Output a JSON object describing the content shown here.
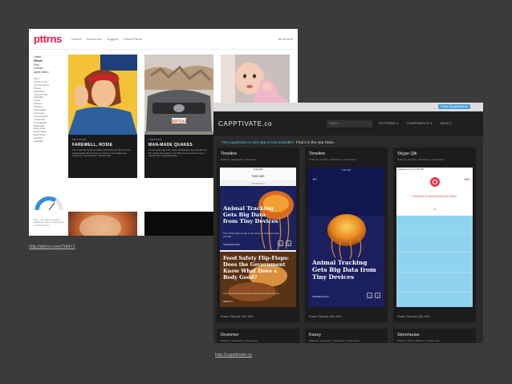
{
  "pttrns": {
    "logo": "pttrns",
    "nav": [
      "Search",
      "Resources",
      "Suggest",
      "Follow Pttrns"
    ],
    "filter": "All Items ▾",
    "devices": [
      "Latest",
      "iPhone",
      "iPad",
      "Android",
      "Apple Watch"
    ],
    "categories": [
      "About",
      "Activity Feeds",
      "Ads Promotions",
      "Browse",
      "Calculators",
      "Camera & Film",
      "Calendars",
      "Charts",
      "Check-in",
      "Checkout",
      "Coach Marks",
      "Comments",
      "Content Detail",
      "Create Post",
      "Cross Selling",
      "Dashboard",
      "Empty Data",
      "Empty States",
      "Event Detail",
      "Favorites",
      "Feedback"
    ],
    "gauge_caption": "Stat — Top Tab-bar, Android Dashboard, Ads by: Real Buying in Startup Brand",
    "cards": {
      "card1": {
        "tag": "FEATURED",
        "title": "FAREWELL, ROSIE",
        "desc": "The model for American Rosie with 'Rosie the Riveter' has passed away. But don't let our forever in the Halloween costumes of generations. Farewell girls."
      },
      "card2": {
        "tag": "TRENDING",
        "title": "MAN-MADE QUAKES",
        "desc": "A new study says man-made earthquakes are increasing in the central and eastern U.S. Which is just a better way of saying we're all getting flatter."
      },
      "plate": "3DFY243"
    },
    "url": "http://pttrns.com/?did=1"
  },
  "capptivate": {
    "follow": "Follow @capptivateco",
    "brand": "CAPPTIVATE.co",
    "search_placeholder": "Search...",
    "menu": [
      "PATTERNS ▾",
      "COMPONENTS ▾",
      "ABOUT"
    ],
    "banner_highlight": "The Capptivate.co iOS app is now available!",
    "banner_rest": "Find it in the App Store.",
    "cards": [
      {
        "title": "Timeline",
        "sub": "Patterns: Navigation, Transitions",
        "posted": "Posted: February 14th, 2015"
      },
      {
        "title": "Timeline",
        "sub": "Patterns: Content, Transitions, UI Elements",
        "posted": "Posted: February 14th, 2015"
      },
      {
        "title": "Skype Qik",
        "sub": "Patterns: Content, Interactive, UI Elements",
        "posted": "Posted: February 14th, 2015"
      }
    ],
    "cards_bottom": [
      {
        "title": "Drummer",
        "sub": "Patterns: Interactive, UI Elements"
      },
      {
        "title": "Keezy",
        "sub": "Patterns: Interactive, Transitions, UI Elements"
      },
      {
        "title": "Storehouse",
        "sub": "Patterns: Pull to Refresh, UI Elements"
      }
    ],
    "phone1": {
      "status_time": "9:41 AM",
      "title": "TIMELINE",
      "day": "YESTERDAY",
      "story1": "Animal Tracking Gets Big Data from Tiny Devices",
      "story1_text": "Tiny GPS tracker a big in the future of tracking small animals",
      "cat1": "TECHNOLOGY",
      "story2": "Food Safety Flip-Flops: Does the Government Know What Does a Body Good?",
      "story2_text": "The government's heads to look to the latest science",
      "cat2": "HEALTH"
    },
    "phone2": {
      "status_time": "9:41 AM",
      "story": "Animal Tracking Gets Big Data from Tiny Devices",
      "cat": "TECHNOLOGY"
    },
    "phone3": {
      "status": "●●●●● Verizon ▾  1:59 PM",
      "pull_text": "Pull down to record your first video."
    },
    "url": "http://capptivate.co"
  }
}
